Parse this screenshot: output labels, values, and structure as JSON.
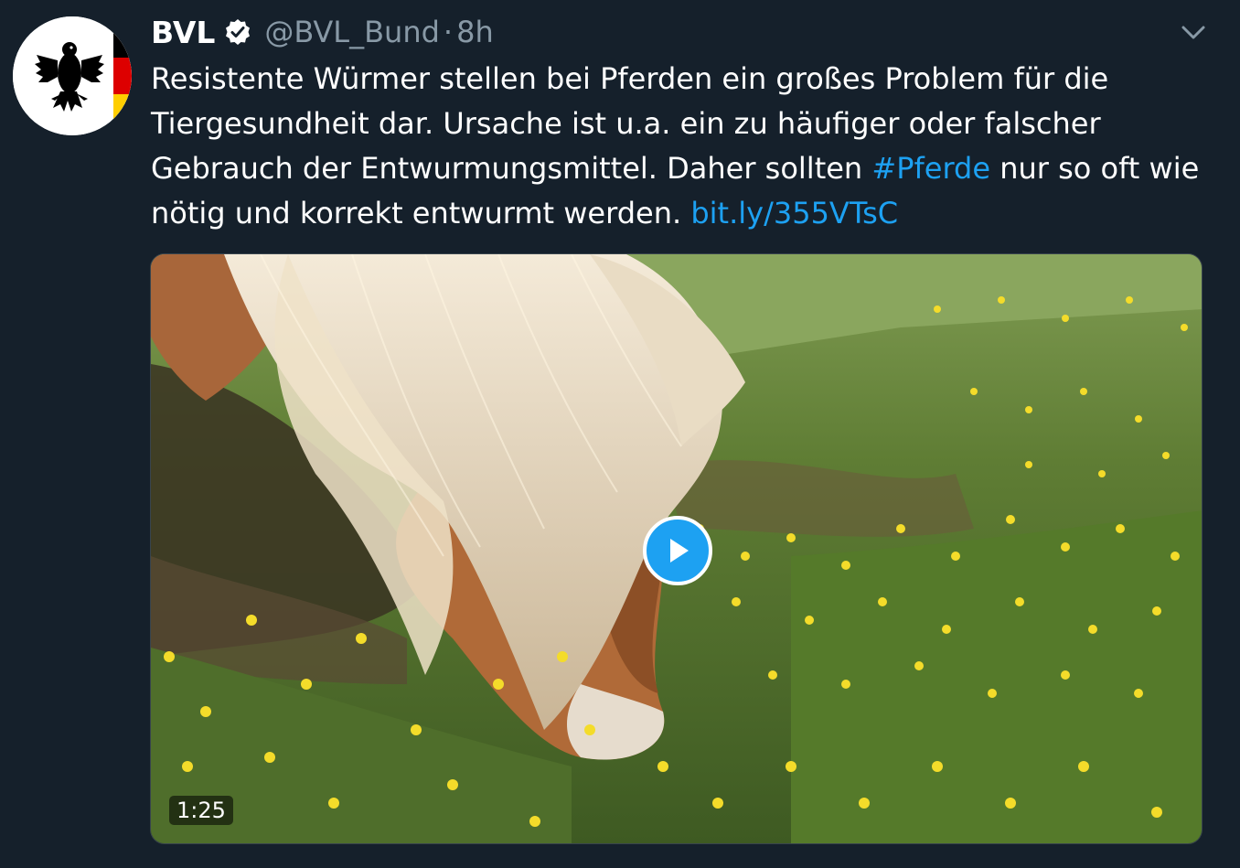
{
  "tweet": {
    "author_name": "BVL",
    "handle": "@BVL_Bund",
    "separator": "·",
    "time": "8h",
    "text_part1": "Resistente Würmer stellen bei Pferden ein großes Problem für die Tiergesundheit dar. Ursache ist u.a. ein zu häufiger oder falscher Gebrauch der Entwurmungsmittel. Daher sollten ",
    "hashtag": "#Pferde",
    "text_part2": " nur so oft wie nötig und korrekt entwurmt werden. ",
    "link": "bit.ly/355VTsC",
    "video_duration": "1:25"
  },
  "icons": {
    "avatar": "federal-eagle-logo",
    "verified": "verified-badge-icon",
    "caret": "chevron-down-icon",
    "play": "play-icon"
  },
  "colors": {
    "background": "#15202b",
    "link": "#1da1f2",
    "secondary_text": "#8899a6",
    "flag_black": "#000000",
    "flag_red": "#dd0000",
    "flag_gold": "#ffce00"
  }
}
